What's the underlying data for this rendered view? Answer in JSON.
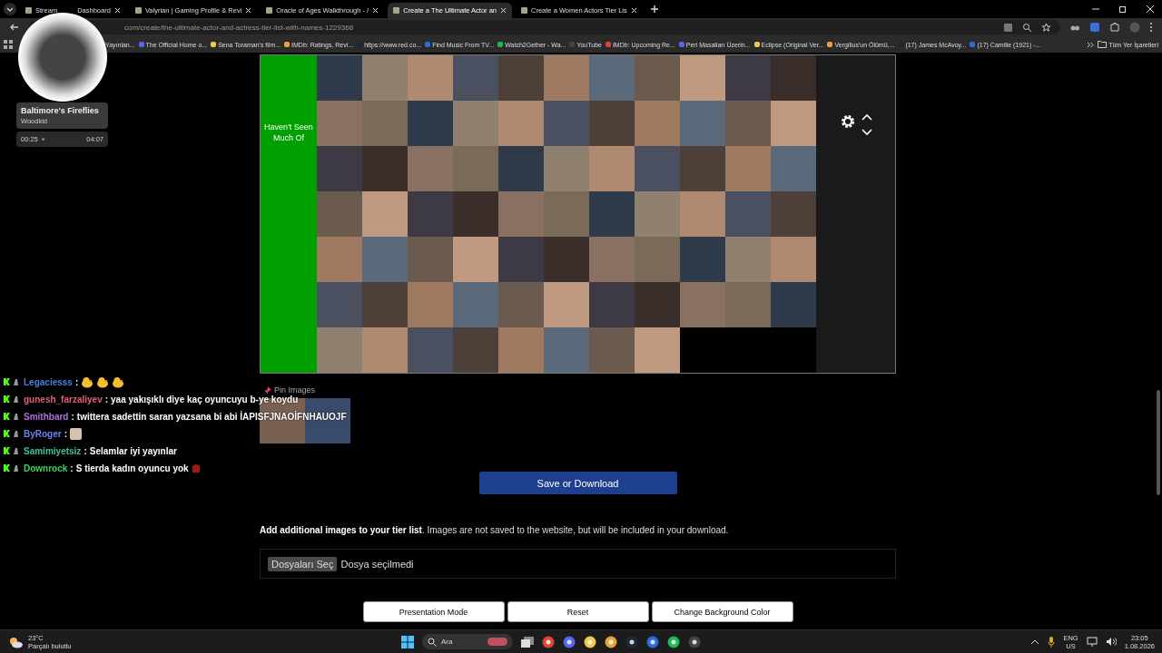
{
  "browser": {
    "tabs": [
      {
        "label": "Stream",
        "label_tail": "Dashboard",
        "selected": false
      },
      {
        "label": "Valyrian | Gaming Profile & Revi",
        "selected": false
      },
      {
        "label": "Oracle of Ages Walkthrough - /",
        "selected": false
      },
      {
        "label": "Create a The Ultimate Actor an",
        "selected": true
      },
      {
        "label": "Create a Women Actors Tier Lis",
        "selected": false
      }
    ],
    "address": "com/create/the-ultimate-actor-and-actress-tier-list-with-names-1229368",
    "bookmarks": [
      "Yayınlan...",
      "The Official Home o...",
      "Sena Toraman's film...",
      "IMDb: Ratings, Revi...",
      "https://www.red.co...",
      "Find Music From TV...",
      "Watch2Gether - Wa...",
      "YouTube",
      "IMDb: Upcoming Re...",
      "Peri Masalları Üzerin...",
      "Eclipse (Original Ver...",
      "Vergilius'un Ölümü,...",
      "(17) James McAvoy...",
      "(17) Camille (1921) -..."
    ],
    "all_bookmarks": "Tüm Yer İşaretleri"
  },
  "overlay": {
    "track": {
      "title": "Baltimore's Fireflies",
      "artist": "Woodkid",
      "elapsed": "00:25",
      "duration": "04:07"
    },
    "chat": [
      {
        "user": "Legaciesss",
        "color": "#4a7fe0",
        "separator": ":",
        "emotes": [
          {
            "kind": "duck"
          },
          {
            "kind": "duck"
          },
          {
            "kind": "duck"
          }
        ]
      },
      {
        "user": "gunesh_farzaliyev",
        "color": "#e0607a",
        "separator": ":",
        "message": "yaa yakışıklı diye kaç oyuncuyu b-ye koydu"
      },
      {
        "user": "Smithbard",
        "color": "#b070e0",
        "separator": ":",
        "message": "twittera sadettin saran yazsana bi abi İAPISFJNAOİFNHAUOJF"
      },
      {
        "user": "ByRoger",
        "color": "#7080f0",
        "separator": ":",
        "emotes": [
          {
            "kind": "picture"
          }
        ]
      },
      {
        "user": "Samimiyetsiz",
        "color": "#40c0a0",
        "separator": ":",
        "message": "Selamlar iyi yayınlar"
      },
      {
        "user": "Downrock",
        "color": "#40d060",
        "separator": ":",
        "message": "S tierda kadın oyuncu yok",
        "emotes": [
          {
            "kind": "sticker"
          }
        ]
      }
    ]
  },
  "tier_list": {
    "rows": [
      {
        "label": "Haven't Seen Much Of",
        "color": "#00a000"
      }
    ]
  },
  "pin_images": {
    "label": "Pin Images"
  },
  "save_button": "Save or Download",
  "additional": {
    "text": "**Add additional images to your tier list**. Images are not saved to the website, but will be included in your download.",
    "file_button": "Dosyaları Seç",
    "file_status": "Dosya seçilmedi"
  },
  "buttons": [
    "Presentation Mode",
    "Reset",
    "Change Background Color"
  ],
  "taskbar": {
    "temperature": "23°C",
    "weather": "Parçalı bulutlu",
    "search_placeholder": "Ara",
    "language": "ENG",
    "layout": "US",
    "time": "23:05",
    "date": "1.08.2026"
  }
}
